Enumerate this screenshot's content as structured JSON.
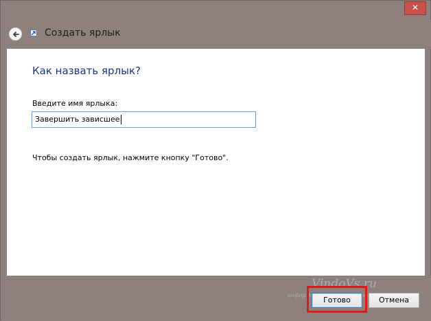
{
  "window": {
    "close_label": "✕"
  },
  "header": {
    "title": "Создать ярлык"
  },
  "main": {
    "question": "Как назвать ярлык?",
    "name_label": "Введите имя ярлыка:",
    "name_value": "Завершить зависшее",
    "hint": "Чтобы создать ярлык, нажмите кнопку \"Готово\"."
  },
  "footer": {
    "ok_label": "Готово",
    "cancel_label": "Отмена",
    "watermark": "VindoVs.ru",
    "watermark_sub": "информация компьютерного мира"
  },
  "colors": {
    "chrome": "#8d807d",
    "question": "#1e3287",
    "highlight": "#e01818",
    "close": "#c7504b"
  },
  "icons": {
    "back": "back-arrow-icon",
    "wizard": "shortcut-icon",
    "close": "close-icon"
  }
}
